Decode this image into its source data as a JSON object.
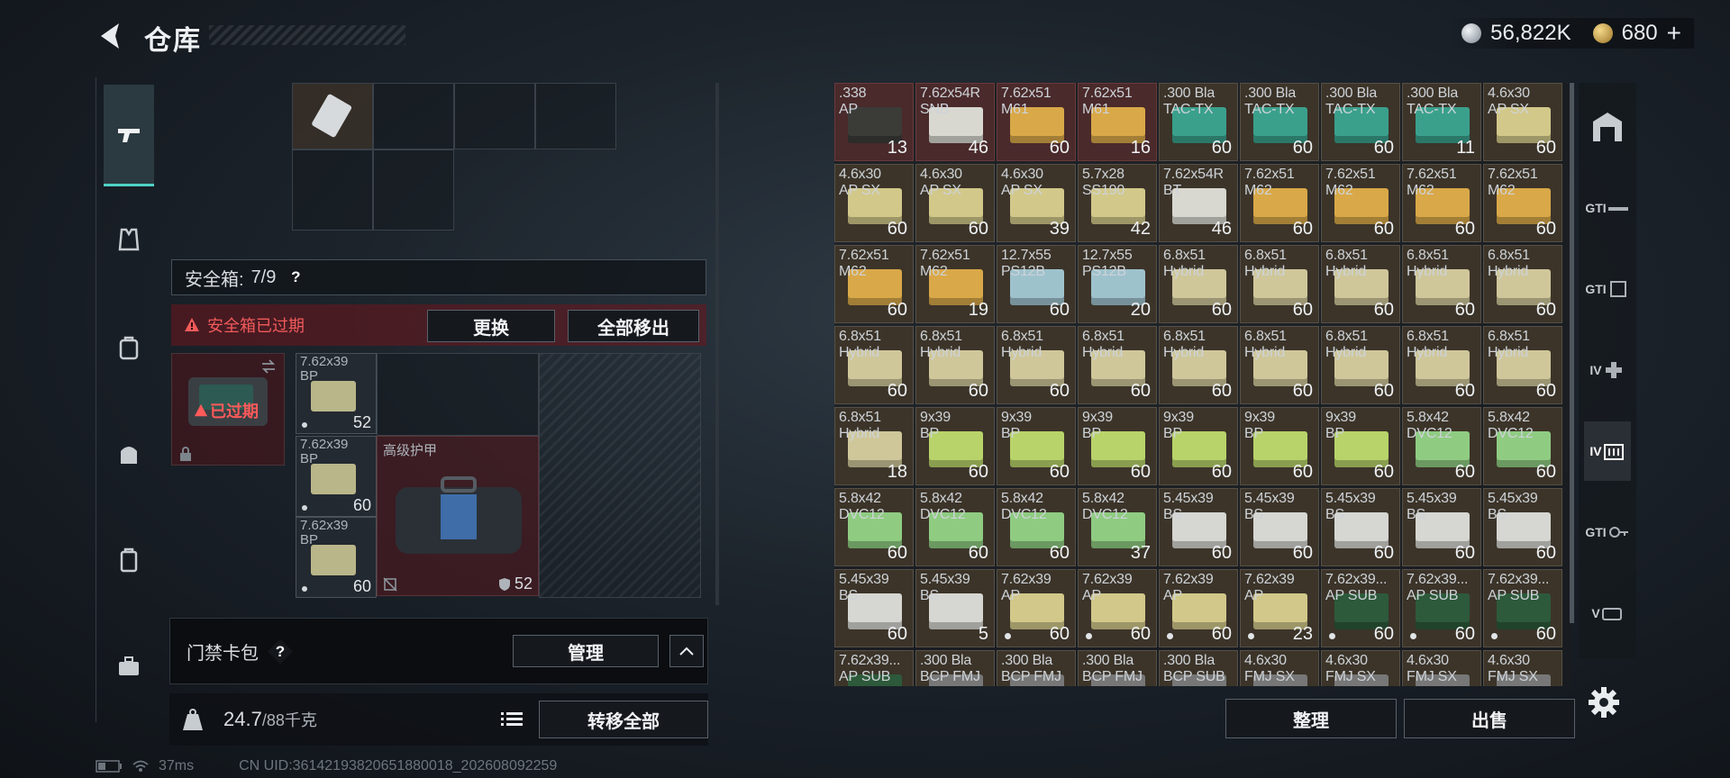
{
  "header": {
    "title": "仓库"
  },
  "currency": {
    "silver": "56,822K",
    "gold": "680",
    "add": "+"
  },
  "safe_box": {
    "label": "安全箱:",
    "capacity": "7/9",
    "help": "?",
    "expired_warning": "安全箱已过期",
    "replace_button": "更换",
    "remove_all_button": "全部移出",
    "case_status": "已过期",
    "items": [
      {
        "name": "7.62x39\nBP",
        "count": "52"
      },
      {
        "name": "7.62x39\nBP",
        "count": "60"
      },
      {
        "name": "7.62x39\nBP",
        "count": "60"
      }
    ],
    "armor_label": "高级护甲",
    "armor_durability": "52"
  },
  "keycard": {
    "label": "门禁卡包",
    "help": "?",
    "manage_button": "管理"
  },
  "weight": {
    "current": "24.7",
    "max": "/88千克",
    "transfer_all_button": "转移全部",
    "kg_icon": "KG"
  },
  "inventory": {
    "rows": [
      [
        {
          "n": ".338\nAP",
          "c": "13",
          "col": "#3b3b38",
          "red": true
        },
        {
          "n": "7.62x54R\nSNB",
          "c": "46",
          "col": "#d8d8d0",
          "red": true
        },
        {
          "n": "7.62x51\nM61",
          "c": "60",
          "col": "#d9a848",
          "red": true
        },
        {
          "n": "7.62x51\nM61",
          "c": "16",
          "col": "#d9a848",
          "red": true
        },
        {
          "n": ".300 Bla\nTAC-TX",
          "c": "60",
          "col": "#3aa08c"
        },
        {
          "n": ".300 Bla\nTAC-TX",
          "c": "60",
          "col": "#3aa08c"
        },
        {
          "n": ".300 Bla\nTAC-TX",
          "c": "60",
          "col": "#3aa08c"
        },
        {
          "n": ".300 Bla\nTAC-TX",
          "c": "11",
          "col": "#3aa08c"
        },
        {
          "n": "4.6x30\nAP SX",
          "c": "60",
          "col": "#d2c88a"
        }
      ],
      [
        {
          "n": "4.6x30\nAP SX",
          "c": "60",
          "col": "#d2c88a"
        },
        {
          "n": "4.6x30\nAP SX",
          "c": "60",
          "col": "#d2c88a"
        },
        {
          "n": "4.6x30\nAP SX",
          "c": "39",
          "col": "#d2c88a"
        },
        {
          "n": "5.7x28\nSS190",
          "c": "42",
          "col": "#d2c88a"
        },
        {
          "n": "7.62x54R\nBT",
          "c": "46",
          "col": "#d8d8d0"
        },
        {
          "n": "7.62x51\nM62",
          "c": "60",
          "col": "#d9a848"
        },
        {
          "n": "7.62x51\nM62",
          "c": "60",
          "col": "#d9a848"
        },
        {
          "n": "7.62x51\nM62",
          "c": "60",
          "col": "#d9a848"
        },
        {
          "n": "7.62x51\nM62",
          "c": "60",
          "col": "#d9a848"
        }
      ],
      [
        {
          "n": "7.62x51\nM62",
          "c": "60",
          "col": "#d9a848"
        },
        {
          "n": "7.62x51\nM62",
          "c": "19",
          "col": "#d9a848"
        },
        {
          "n": "12.7x55\nPS12B",
          "c": "60",
          "col": "#9ec2cc"
        },
        {
          "n": "12.7x55\nPS12B",
          "c": "20",
          "col": "#9ec2cc"
        },
        {
          "n": "6.8x51\nHybrid",
          "c": "60",
          "col": "#cfc79a"
        },
        {
          "n": "6.8x51\nHybrid",
          "c": "60",
          "col": "#cfc79a"
        },
        {
          "n": "6.8x51\nHybrid",
          "c": "60",
          "col": "#cfc79a"
        },
        {
          "n": "6.8x51\nHybrid",
          "c": "60",
          "col": "#cfc79a"
        },
        {
          "n": "6.8x51\nHybrid",
          "c": "60",
          "col": "#cfc79a"
        }
      ],
      [
        {
          "n": "6.8x51\nHybrid",
          "c": "60",
          "col": "#cfc79a"
        },
        {
          "n": "6.8x51\nHybrid",
          "c": "60",
          "col": "#cfc79a"
        },
        {
          "n": "6.8x51\nHybrid",
          "c": "60",
          "col": "#cfc79a"
        },
        {
          "n": "6.8x51\nHybrid",
          "c": "60",
          "col": "#cfc79a"
        },
        {
          "n": "6.8x51\nHybrid",
          "c": "60",
          "col": "#cfc79a"
        },
        {
          "n": "6.8x51\nHybrid",
          "c": "60",
          "col": "#cfc79a"
        },
        {
          "n": "6.8x51\nHybrid",
          "c": "60",
          "col": "#cfc79a"
        },
        {
          "n": "6.8x51\nHybrid",
          "c": "60",
          "col": "#cfc79a"
        },
        {
          "n": "6.8x51\nHybrid",
          "c": "60",
          "col": "#cfc79a"
        }
      ],
      [
        {
          "n": "6.8x51\nHybrid",
          "c": "18",
          "col": "#cfc79a"
        },
        {
          "n": "9x39\nBP",
          "c": "60",
          "col": "#b8d36a"
        },
        {
          "n": "9x39\nBP",
          "c": "60",
          "col": "#b8d36a"
        },
        {
          "n": "9x39\nBP",
          "c": "60",
          "col": "#b8d36a"
        },
        {
          "n": "9x39\nBP",
          "c": "60",
          "col": "#b8d36a"
        },
        {
          "n": "9x39\nBP",
          "c": "60",
          "col": "#b8d36a"
        },
        {
          "n": "9x39\nBP",
          "c": "60",
          "col": "#b8d36a"
        },
        {
          "n": "5.8x42\nDVC12",
          "c": "60",
          "col": "#8fcc82"
        },
        {
          "n": "5.8x42\nDVC12",
          "c": "60",
          "col": "#8fcc82"
        }
      ],
      [
        {
          "n": "5.8x42\nDVC12",
          "c": "60",
          "col": "#8fcc82"
        },
        {
          "n": "5.8x42\nDVC12",
          "c": "60",
          "col": "#8fcc82"
        },
        {
          "n": "5.8x42\nDVC12",
          "c": "60",
          "col": "#8fcc82"
        },
        {
          "n": "5.8x42\nDVC12",
          "c": "37",
          "col": "#8fcc82"
        },
        {
          "n": "5.45x39\nBS",
          "c": "60",
          "col": "#d6d6d2"
        },
        {
          "n": "5.45x39\nBS",
          "c": "60",
          "col": "#d6d6d2"
        },
        {
          "n": "5.45x39\nBS",
          "c": "60",
          "col": "#d6d6d2"
        },
        {
          "n": "5.45x39\nBS",
          "c": "60",
          "col": "#d6d6d2"
        },
        {
          "n": "5.45x39\nBS",
          "c": "60",
          "col": "#d6d6d2"
        }
      ],
      [
        {
          "n": "5.45x39\nBS",
          "c": "60",
          "col": "#d6d6d2"
        },
        {
          "n": "5.45x39\nBS",
          "c": "5",
          "col": "#d6d6d2"
        },
        {
          "n": "7.62x39\nAP",
          "c": "60",
          "col": "#d2c88a",
          "dot": true
        },
        {
          "n": "7.62x39\nAP",
          "c": "60",
          "col": "#d2c88a",
          "dot": true
        },
        {
          "n": "7.62x39\nAP",
          "c": "60",
          "col": "#d2c88a",
          "dot": true
        },
        {
          "n": "7.62x39\nAP",
          "c": "23",
          "col": "#d2c88a",
          "dot": true
        },
        {
          "n": "7.62x39...\nAP SUB",
          "c": "60",
          "col": "#2d5a3a",
          "dot": true
        },
        {
          "n": "7.62x39...\nAP SUB",
          "c": "60",
          "col": "#2d5a3a",
          "dot": true
        },
        {
          "n": "7.62x39...\nAP SUB",
          "c": "60",
          "col": "#2d5a3a",
          "dot": true
        }
      ],
      [
        {
          "n": "7.62x39...\nAP SUB",
          "c": "",
          "col": "#2d5a3a"
        },
        {
          "n": ".300 Bla\nBCP FMJ",
          "c": "",
          "col": "#777"
        },
        {
          "n": ".300 Bla\nBCP FMJ",
          "c": "",
          "col": "#777"
        },
        {
          "n": ".300 Bla\nBCP FMJ",
          "c": "",
          "col": "#777"
        },
        {
          "n": ".300 Bla\nBCP SUB",
          "c": "",
          "col": "#777"
        },
        {
          "n": "4.6x30\nFMJ SX",
          "c": "",
          "col": "#777"
        },
        {
          "n": "4.6x30\nFMJ SX",
          "c": "",
          "col": "#777"
        },
        {
          "n": "4.6x30\nFMJ SX",
          "c": "",
          "col": "#777"
        },
        {
          "n": "4.6x30\nFMJ SX",
          "c": "",
          "col": "#777"
        }
      ]
    ],
    "sort_button": "整理",
    "sell_button": "出售"
  },
  "right_tabs": [
    "GTI",
    "GTI",
    "IV",
    "IV",
    "GTI",
    "V"
  ],
  "status": {
    "ping": "37ms",
    "uid": "CN UID:3614219382065188001​8_202608092259"
  }
}
